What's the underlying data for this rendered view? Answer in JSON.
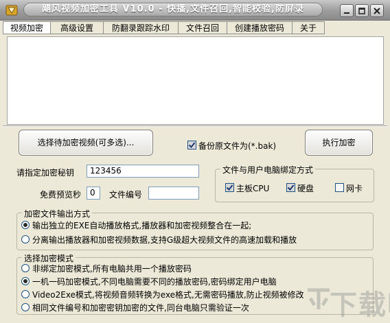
{
  "window": {
    "title": "飓风视频加密工具 V10.0 - 快播,文件召回,智能校验,防屏录"
  },
  "menu": [
    {
      "label": "视频加密"
    },
    {
      "label": "高级设置"
    },
    {
      "label": "防翻录跟踪水印"
    },
    {
      "label": "文件召回"
    },
    {
      "label": "创建播放密码"
    },
    {
      "label": "关于"
    }
  ],
  "actions": {
    "select_videos_label": "选择待加密视频(可多选)...",
    "backup_label": "备份原文件为(*.bak)",
    "backup_checked": true,
    "execute_label": "执行加密"
  },
  "form": {
    "secret_key_label": "请指定加密秘钥",
    "secret_key_value": "123456",
    "preview_label": "免费预览秒",
    "preview_value": "0",
    "file_number_label": "文件编号",
    "file_number_value": ""
  },
  "binding": {
    "title": "文件与用户电脑绑定方式",
    "options": [
      {
        "label": "主板CPU",
        "checked": true
      },
      {
        "label": "硬盘",
        "checked": true
      },
      {
        "label": "网卡",
        "checked": false
      }
    ]
  },
  "output_mode": {
    "title": "加密文件输出方式",
    "options": [
      {
        "label": "输出独立的EXE自动播放格式,播放器和加密视频整合在一起;",
        "selected": true
      },
      {
        "label": "分离输出播放器和加密视频数据,支持G级超大视频文件的高速加载和播放",
        "selected": false
      }
    ]
  },
  "encrypt_mode": {
    "title": "选择加密模式",
    "options": [
      {
        "label": "非绑定加密模式,所有电脑共用一个播放密码",
        "selected": false
      },
      {
        "label": "一机一码加密模式,不同电脑需要不同的播放密码,密码绑定用户电脑",
        "selected": true
      },
      {
        "label": "Video2Exe模式,将视频音频转换为exe格式,无需密码播放,防止视频被修改",
        "selected": false
      },
      {
        "label": "相同文件编号和加密密钥加密的文件,同台电脑只需验证一次",
        "selected": false
      }
    ]
  },
  "watermark": {
    "text": "下载吧"
  },
  "colors": {
    "window_bg": "#ece9d8",
    "title_text": "#ffffff",
    "check_color": "#1e3a6e"
  }
}
